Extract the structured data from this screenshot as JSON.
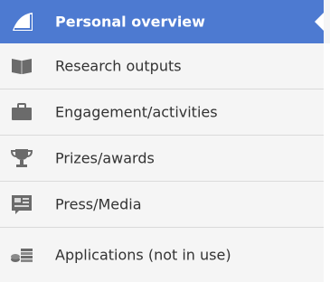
{
  "menu": {
    "items": [
      {
        "label": "Personal overview",
        "icon": "overview-icon",
        "active": true
      },
      {
        "label": "Research outputs",
        "icon": "book-icon",
        "active": false
      },
      {
        "label": "Engagement/activities",
        "icon": "briefcase-icon",
        "active": false
      },
      {
        "label": "Prizes/awards",
        "icon": "trophy-icon",
        "active": false
      },
      {
        "label": "Press/Media",
        "icon": "newspaper-icon",
        "active": false
      },
      {
        "label": "Applications (not in use)",
        "icon": "money-icon",
        "active": false
      }
    ]
  },
  "colors": {
    "active_bg": "#4d7ad1",
    "item_bg": "#f5f5f5",
    "icon": "#6b6b6b",
    "text": "#333333",
    "divider": "#dadada"
  }
}
